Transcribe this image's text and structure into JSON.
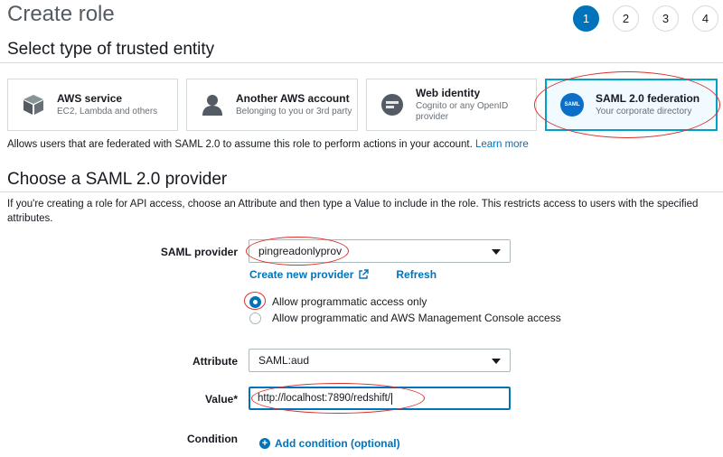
{
  "header": {
    "title": "Create role",
    "steps": [
      "1",
      "2",
      "3",
      "4"
    ],
    "active_step": "1"
  },
  "trusted_entity": {
    "heading": "Select type of trusted entity",
    "cards": [
      {
        "title": "AWS service",
        "subtitle": "EC2, Lambda and others",
        "icon": "cube-icon"
      },
      {
        "title": "Another AWS account",
        "subtitle": "Belonging to you or 3rd party",
        "icon": "user-icon"
      },
      {
        "title": "Web identity",
        "subtitle": "Cognito or any OpenID provider",
        "icon": "web-identity-icon"
      },
      {
        "title": "SAML 2.0 federation",
        "subtitle": "Your corporate directory",
        "icon": "saml-icon",
        "icon_text": "SAML",
        "selected": true
      }
    ],
    "info": "Allows users that are federated with SAML 2.0 to assume this role to perform actions in your account.",
    "learn_more": "Learn more"
  },
  "provider": {
    "heading": "Choose a SAML 2.0 provider",
    "description": "If you're creating a role for API access, choose an Attribute and then type a Value to include in the role. This restricts access to users with the specified attributes.",
    "saml_provider_label": "SAML provider",
    "saml_provider_value": "pingreadonlyprov",
    "create_new_provider": "Create new provider",
    "refresh": "Refresh",
    "access_options": [
      {
        "label": "Allow programmatic access only",
        "selected": true
      },
      {
        "label": "Allow programmatic and AWS Management Console access",
        "selected": false
      }
    ],
    "attribute_label": "Attribute",
    "attribute_value": "SAML:aud",
    "value_label": "Value*",
    "value_input": "http://localhost:7890/redshift/",
    "condition_label": "Condition",
    "add_condition": "Add condition (optional)"
  },
  "colors": {
    "accent": "#0073bb",
    "annotation": "#d9322b",
    "selected_card_bg": "#f1faff"
  }
}
